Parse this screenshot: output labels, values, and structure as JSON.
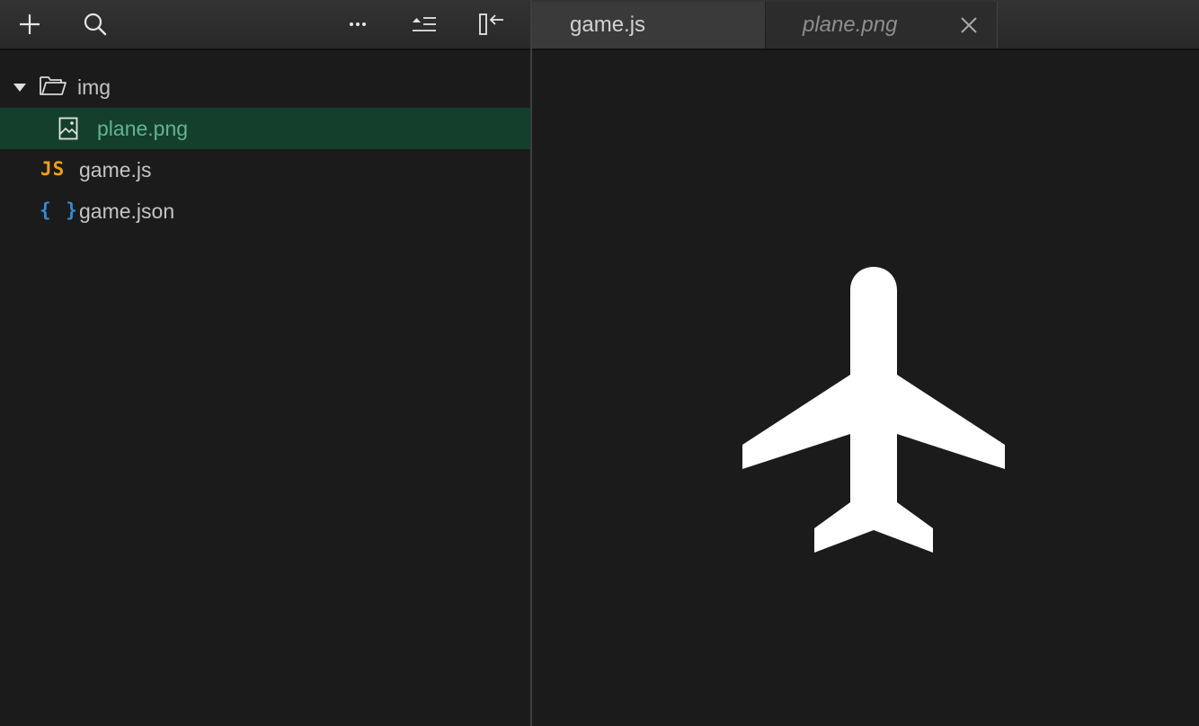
{
  "toolbar": {
    "buttons": [
      {
        "name": "new-file-button",
        "icon": "plus-icon"
      },
      {
        "name": "search-button",
        "icon": "search-icon"
      },
      {
        "name": "more-button",
        "icon": "more-icon"
      },
      {
        "name": "collapse-all-button",
        "icon": "collapse-list-icon"
      },
      {
        "name": "hide-sidebar-button",
        "icon": "panel-collapse-icon"
      }
    ]
  },
  "tabs": [
    {
      "label": "game.js",
      "active": true
    },
    {
      "label": "plane.png",
      "active": false,
      "preview": true,
      "closable": true
    }
  ],
  "sidebar": {
    "tree": [
      {
        "label": "img",
        "type": "folder",
        "expanded": true,
        "icon": "folder-open-icon"
      },
      {
        "label": "plane.png",
        "type": "image",
        "selected": true,
        "icon": "image-file-icon"
      },
      {
        "label": "game.js",
        "type": "js",
        "icon_text": "JS"
      },
      {
        "label": "game.json",
        "type": "json",
        "icon_text": "{ }"
      }
    ]
  },
  "editor": {
    "preview_icon": "airplane-icon"
  },
  "colors": {
    "selection_bg": "#143f2d",
    "selection_text": "#63b48d",
    "js_icon": "#f0a10f",
    "json_icon": "#2d8ed8",
    "background": "#1b1b1b"
  }
}
